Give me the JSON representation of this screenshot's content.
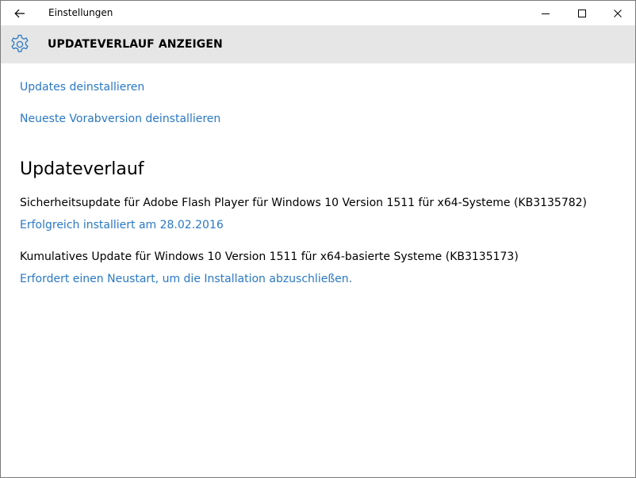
{
  "window": {
    "app_title": "Einstellungen"
  },
  "header": {
    "title": "UPDATEVERLAUF ANZEIGEN",
    "icon": "gear-icon"
  },
  "actions": {
    "uninstall_updates": "Updates deinstallieren",
    "uninstall_preview": "Neueste Vorabversion deinstallieren"
  },
  "history": {
    "title": "Updateverlauf",
    "items": [
      {
        "name": "Sicherheitsupdate für Adobe Flash Player für Windows 10 Version 1511 für x64-Systeme (KB3135782)",
        "status": "Erfolgreich installiert am 28.02.2016"
      },
      {
        "name": "Kumulatives Update für Windows 10 Version 1511 für x64-basierte Systeme (KB3135173)",
        "status": "Erfordert einen Neustart, um die Installation abzuschließen."
      }
    ]
  },
  "colors": {
    "accent": "#2a78c6",
    "header_bg": "#e6e6e6",
    "text": "#000000"
  }
}
